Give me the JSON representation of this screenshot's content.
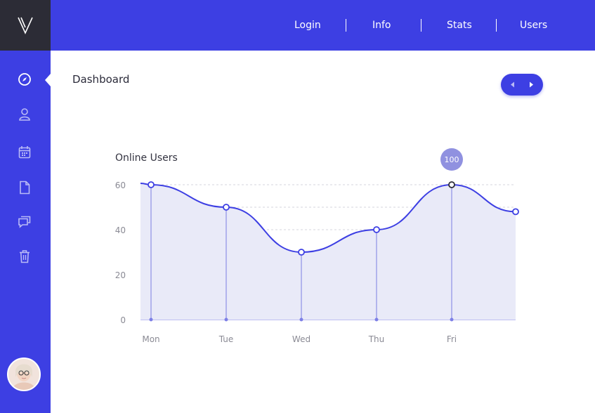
{
  "app": {
    "logo_text": "V"
  },
  "header": {
    "nav": [
      {
        "label": "Login"
      },
      {
        "label": "Info"
      },
      {
        "label": "Stats"
      },
      {
        "label": "Users"
      }
    ]
  },
  "sidebar": {
    "items": [
      {
        "icon": "compass-icon",
        "active": true
      },
      {
        "icon": "user-icon",
        "active": false
      },
      {
        "icon": "calendar-icon",
        "active": false
      },
      {
        "icon": "document-icon",
        "active": false
      },
      {
        "icon": "chat-icon",
        "active": false
      },
      {
        "icon": "trash-icon",
        "active": false
      }
    ]
  },
  "main": {
    "title": "Dashboard",
    "pager": {
      "prev_icon": "caret-left-icon",
      "next_icon": "caret-right-icon"
    }
  },
  "colors": {
    "accent": "#3d3fe3",
    "dark": "#2c2c36",
    "area_fill": "#e9eaf8",
    "badge": "#9091e0"
  },
  "chart_data": {
    "type": "area",
    "title": "Online Users",
    "categories": [
      "Mon",
      "Tue",
      "Wed",
      "Thu",
      "Fri"
    ],
    "values": [
      60,
      50,
      30,
      40,
      60
    ],
    "trailing_value": 48,
    "y_ticks": [
      0,
      20,
      40,
      60
    ],
    "ylim": [
      0,
      60
    ],
    "grid": true,
    "highlight": {
      "category": "Fri",
      "label": "100"
    }
  }
}
